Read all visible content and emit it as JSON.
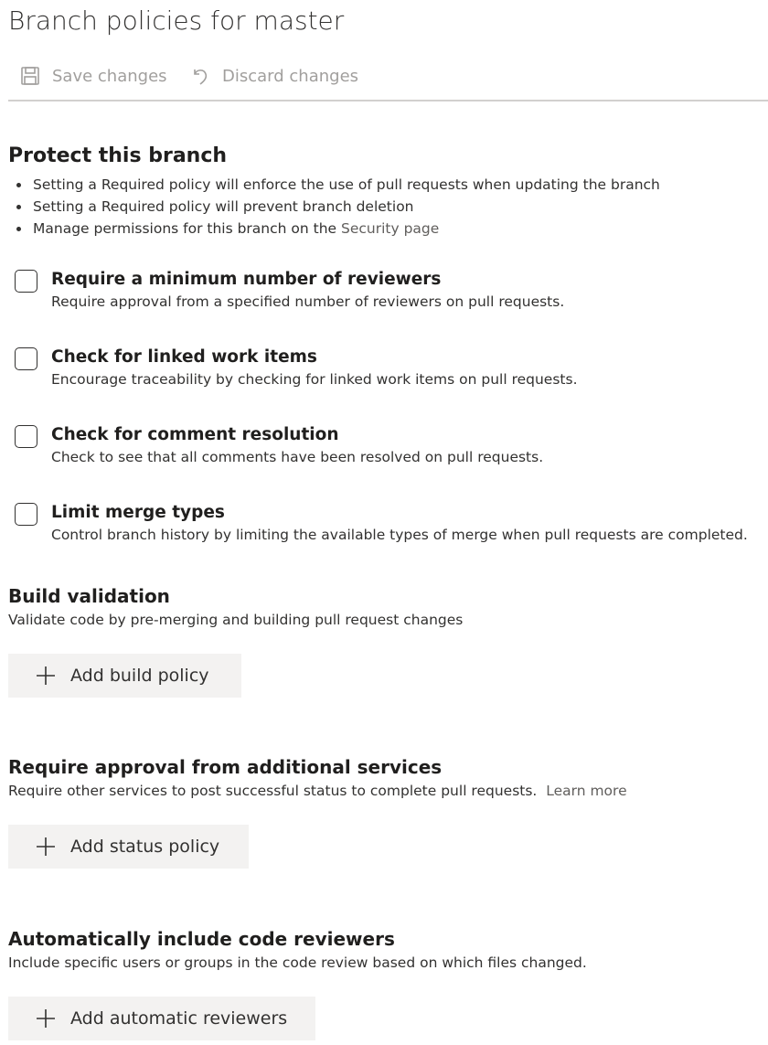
{
  "page": {
    "title": "Branch policies for master"
  },
  "toolbar": {
    "save_label": "Save changes",
    "discard_label": "Discard changes"
  },
  "protect": {
    "title": "Protect this branch",
    "bullets": [
      "Setting a Required policy will enforce the use of pull requests when updating the branch",
      "Setting a Required policy will prevent branch deletion"
    ],
    "bullet3_prefix": "Manage permissions for this branch on the ",
    "bullet3_link": "Security page"
  },
  "policies": [
    {
      "title": "Require a minimum number of reviewers",
      "description": "Require approval from a specified number of reviewers on pull requests.",
      "checked": false
    },
    {
      "title": "Check for linked work items",
      "description": "Encourage traceability by checking for linked work items on pull requests.",
      "checked": false
    },
    {
      "title": "Check for comment resolution",
      "description": "Check to see that all comments have been resolved on pull requests.",
      "checked": false
    },
    {
      "title": "Limit merge types",
      "description": "Control branch history by limiting the available types of merge when pull requests are completed.",
      "checked": false
    }
  ],
  "build_validation": {
    "title": "Build validation",
    "description": "Validate code by pre-merging and building pull request changes",
    "button_label": "Add build policy"
  },
  "additional_services": {
    "title": "Require approval from additional services",
    "description": "Require other services to post successful status to complete pull requests.",
    "learn_more": "Learn more",
    "button_label": "Add status policy"
  },
  "auto_reviewers": {
    "title": "Automatically include code reviewers",
    "description": "Include specific users or groups in the code review based on which files changed.",
    "button_label": "Add automatic reviewers"
  },
  "icons": {
    "save": "save-icon",
    "discard": "undo-icon",
    "add": "plus-icon"
  },
  "colors": {
    "disabled_text": "#a19f9d",
    "button_bg": "#f3f2f1",
    "link": "#605e5c"
  }
}
